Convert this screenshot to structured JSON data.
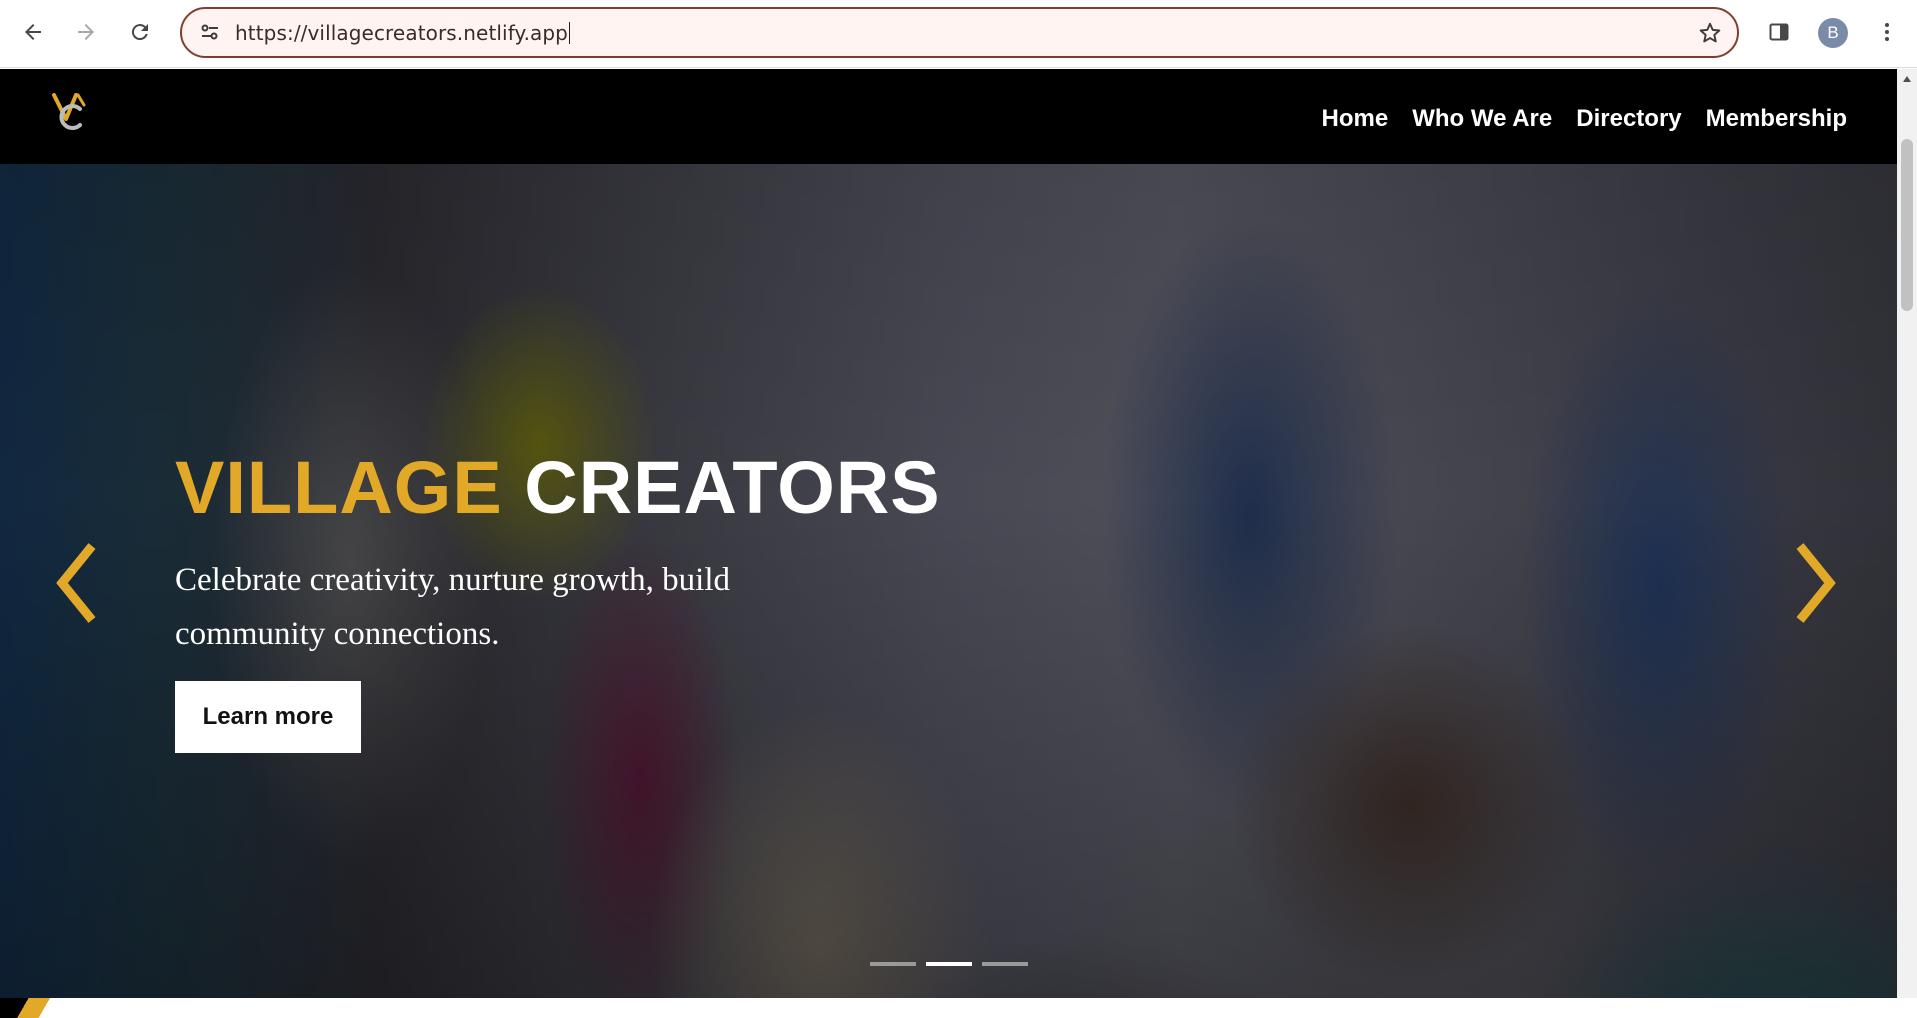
{
  "browser": {
    "url": "https://villagecreators.netlify.app",
    "profile_initial": "B",
    "icons": {
      "back": "back-arrow-icon",
      "forward": "forward-arrow-icon",
      "reload": "reload-icon",
      "site_info": "site-settings-icon",
      "bookmark": "star-icon",
      "side_panel": "side-panel-icon",
      "menu": "kebab-menu-icon"
    }
  },
  "site": {
    "logo_icon": "vc-logo-icon",
    "nav": [
      "Home",
      "Who We Are",
      "Directory",
      "Membership"
    ]
  },
  "hero": {
    "title_word1": "VILLAGE",
    "title_word2": "CREATORS",
    "subtitle": "Celebrate creativity, nurture growth, build community connections.",
    "cta_label": "Learn more",
    "slides_total": 3,
    "active_slide": 2,
    "prev_icon": "chevron-left-icon",
    "next_icon": "chevron-right-icon"
  },
  "colors": {
    "brand_gold": "#e2a928",
    "header_bg": "#000000",
    "omnibox_border": "#7f3f2f"
  }
}
